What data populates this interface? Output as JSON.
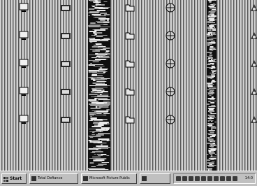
{
  "desktop": {
    "background": "#9c9c9c",
    "icons": [
      {
        "id": "computer",
        "label": "",
        "icon": "computer-icon"
      },
      {
        "id": "network",
        "label": "",
        "icon": "network-icon"
      },
      {
        "id": "inbox",
        "label": "",
        "icon": "inbox-icon"
      },
      {
        "id": "tools",
        "label": "",
        "icon": "tools-icon"
      },
      {
        "id": "recycle",
        "label": "",
        "icon": "recycle-bin-icon"
      },
      {
        "id": "accessibility",
        "label": "",
        "icon": "accessibility-icon"
      },
      {
        "id": "internet",
        "label": "",
        "icon": "globe-icon"
      },
      {
        "id": "media",
        "label": "",
        "icon": "media-icon"
      },
      {
        "id": "folder1",
        "label": "",
        "icon": "folder-icon"
      },
      {
        "id": "editor",
        "label": "",
        "icon": "document-icon"
      },
      {
        "id": "setup",
        "label": "",
        "icon": "setup-icon"
      },
      {
        "id": "camera",
        "label": "",
        "icon": "camera-icon"
      },
      {
        "id": "monitor",
        "label": "",
        "icon": "monitor-icon"
      },
      {
        "id": "app1",
        "label": "",
        "icon": "application-icon"
      },
      {
        "id": "folder2",
        "label": "",
        "icon": "folder-icon"
      },
      {
        "id": "archive",
        "label": "",
        "icon": "archive-icon"
      },
      {
        "id": "images",
        "label": "",
        "icon": "image-icon"
      },
      {
        "id": "utility",
        "label": "",
        "icon": "utility-icon"
      },
      {
        "id": "chart",
        "label": "",
        "icon": "chart-icon"
      },
      {
        "id": "search",
        "label": "",
        "icon": "search-icon"
      },
      {
        "id": "tool2",
        "label": "",
        "icon": "wrench-icon"
      },
      {
        "id": "music",
        "label": "",
        "icon": "music-icon"
      },
      {
        "id": "paint",
        "label": "",
        "icon": "paint-icon"
      },
      {
        "id": "help",
        "label": "",
        "icon": "help-icon"
      },
      {
        "id": "terminal",
        "label": "",
        "icon": "terminal-icon"
      },
      {
        "id": "game",
        "label": "",
        "icon": "game-icon"
      },
      {
        "id": "notes",
        "label": "",
        "icon": "notes-icon"
      },
      {
        "id": "settings",
        "label": "",
        "icon": "gear-icon"
      },
      {
        "id": "player",
        "label": "",
        "icon": "player-icon"
      },
      {
        "id": "link",
        "label": "",
        "icon": "link-icon"
      }
    ]
  },
  "taskbar": {
    "start_label": "Start",
    "buttons": [
      {
        "label": "Total Defiance",
        "icon": "app-icon"
      },
      {
        "label": "Microsoft Picture Publis",
        "icon": "app-icon"
      },
      {
        "label": "",
        "icon": "app-icon"
      }
    ],
    "clock": "14:0"
  }
}
